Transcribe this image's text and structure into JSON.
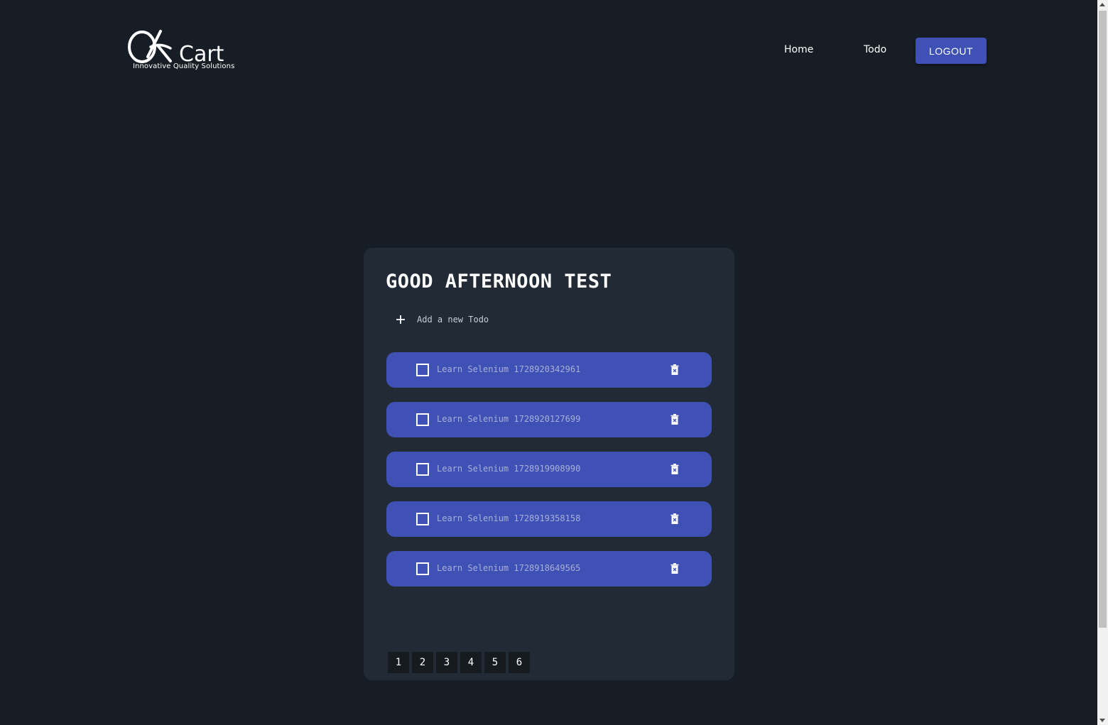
{
  "header": {
    "logo_tagline": "Innovative Quality Solutions",
    "logo_alt": "QKart",
    "nav": [
      {
        "label": "Home"
      },
      {
        "label": "Todo"
      }
    ],
    "logout_label": "LOGOUT"
  },
  "main": {
    "greeting": "GOOD AFTERNOON TEST",
    "add_placeholder": "Add a new Todo",
    "todos": [
      {
        "text": "Learn Selenium 1728920342961",
        "done": false
      },
      {
        "text": "Learn Selenium 1728920127699",
        "done": false
      },
      {
        "text": "Learn Selenium 1728919908990",
        "done": false
      },
      {
        "text": "Learn Selenium 1728919358158",
        "done": false
      },
      {
        "text": "Learn Selenium 1728918649565",
        "done": false
      }
    ],
    "pages": [
      "1",
      "2",
      "3",
      "4",
      "5",
      "6"
    ]
  },
  "colors": {
    "background": "#171d25",
    "card": "#212a35",
    "accent": "#3f51b5"
  },
  "icons": {
    "add": "plus-icon",
    "delete": "trash-icon",
    "checkbox": "checkbox-icon"
  }
}
